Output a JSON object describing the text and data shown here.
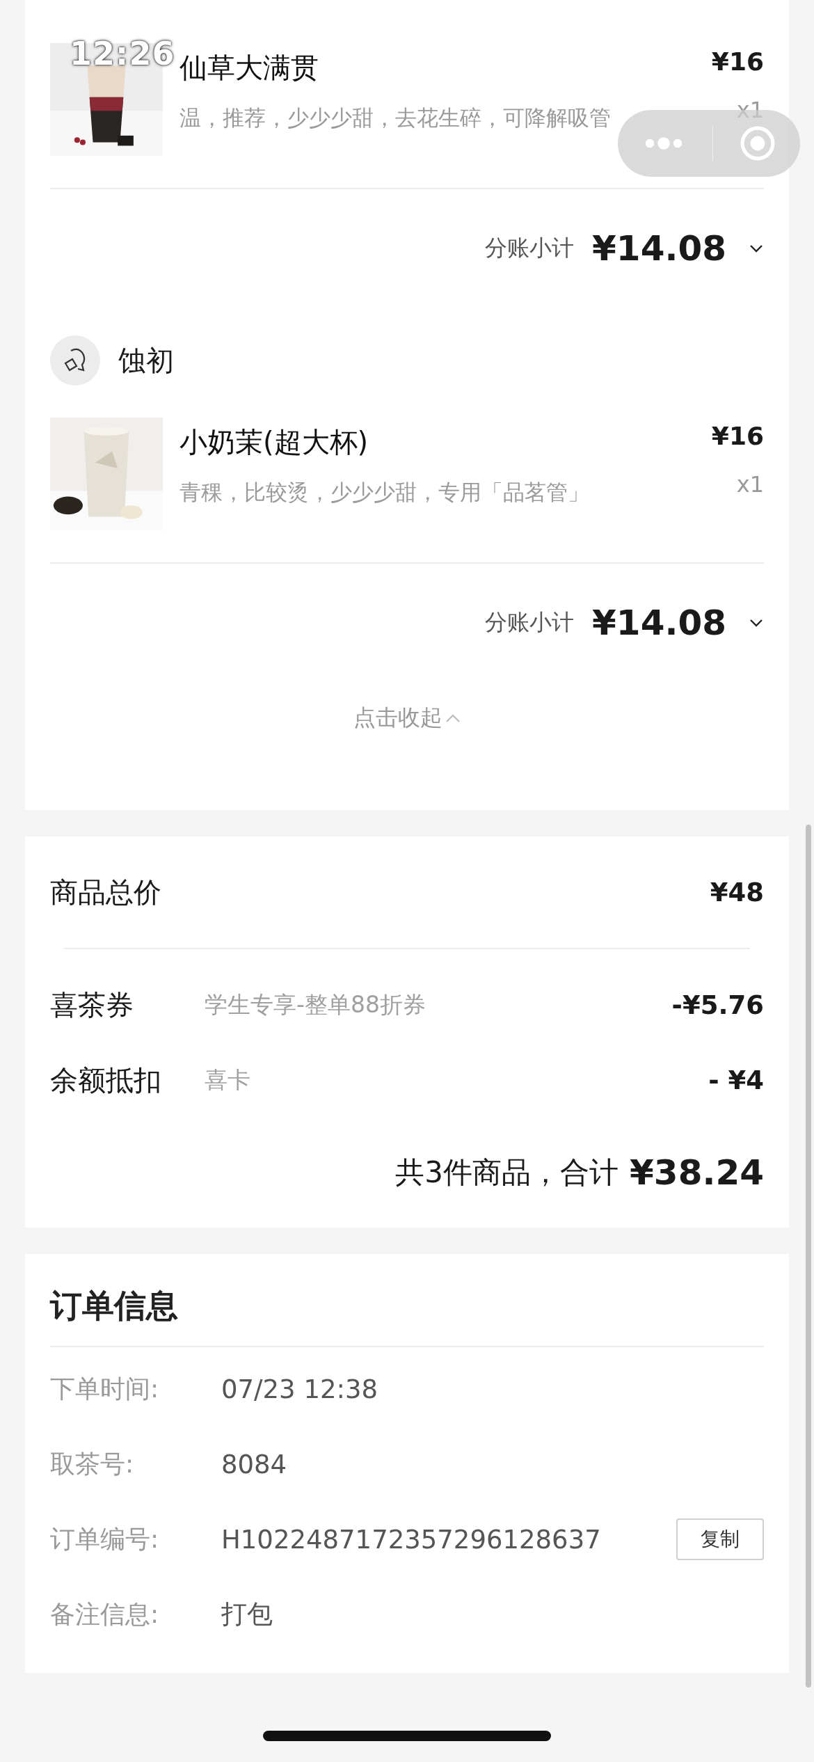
{
  "status_bar": {
    "time": "12:26"
  },
  "stores": [
    {
      "items": [
        {
          "name": "仙草大满贯",
          "options": "温，推荐，少少少甜，去花生碎，可降解吸管",
          "price": "¥16",
          "quantity": "x1"
        }
      ],
      "subtotal_label": "分账小计",
      "subtotal": "¥14.08"
    },
    {
      "name": "蚀初",
      "items": [
        {
          "name": "小奶茉(超大杯)",
          "options": "青稞，比较烫，少少少甜，专用「品茗管」",
          "price": "¥16",
          "quantity": "x1"
        }
      ],
      "subtotal_label": "分账小计",
      "subtotal": "¥14.08"
    }
  ],
  "collapse_link": "点击收起",
  "price_summary": {
    "total_label": "商品总价",
    "total": "¥48",
    "discounts": [
      {
        "label": "喜茶券",
        "detail": "学生专享-整单88折券",
        "amount": "-¥5.76"
      },
      {
        "label": "余额抵扣",
        "detail": "喜卡",
        "amount": "- ¥4"
      }
    ],
    "grand_total_text": "共3件商品，合计",
    "grand_total": "¥38.24"
  },
  "order_info": {
    "title": "订单信息",
    "rows": [
      {
        "label": "下单时间:",
        "value": "07/23 12:38"
      },
      {
        "label": "取茶号:",
        "value": "8084"
      },
      {
        "label": "订单编号:",
        "value": "H1022487172357296128637",
        "action": "复制"
      },
      {
        "label": "备注信息:",
        "value": "打包"
      }
    ]
  }
}
